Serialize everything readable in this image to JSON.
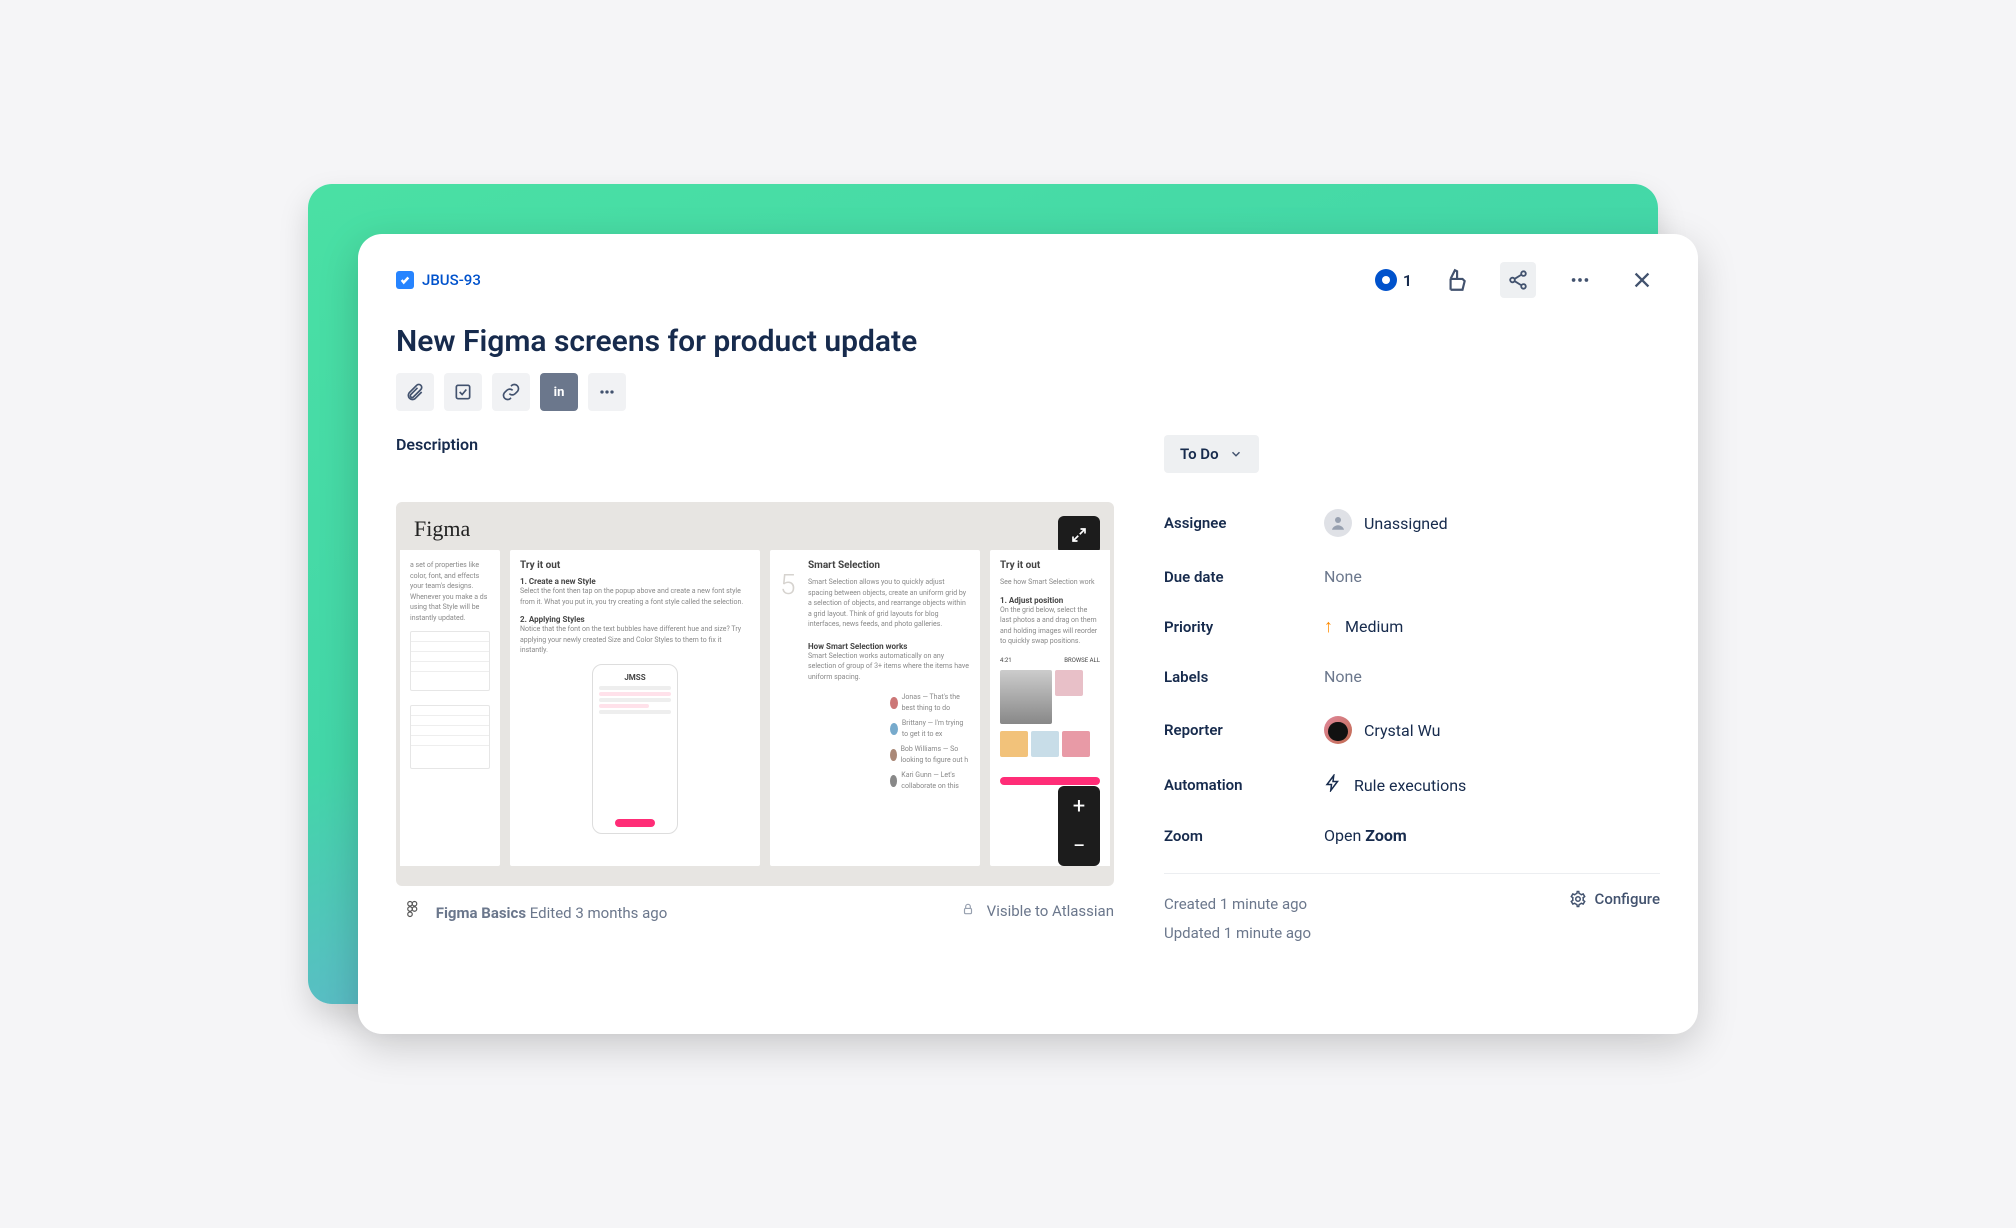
{
  "issue": {
    "key": "JBUS-93",
    "title": "New Figma screens for product update"
  },
  "description_label": "Description",
  "watch_count": "1",
  "status": {
    "label": "To Do"
  },
  "fields": {
    "assignee": {
      "label": "Assignee",
      "value": "Unassigned"
    },
    "due_date": {
      "label": "Due date",
      "value": "None"
    },
    "priority": {
      "label": "Priority",
      "value": "Medium"
    },
    "labels": {
      "label": "Labels",
      "value": "None"
    },
    "reporter": {
      "label": "Reporter",
      "value": "Crystal Wu"
    },
    "automation": {
      "label": "Automation",
      "value": "Rule executions"
    },
    "zoom": {
      "label": "Zoom",
      "value_prefix": "Open ",
      "value_bold": "Zoom"
    }
  },
  "meta": {
    "created": "Created 1 minute ago",
    "updated": "Updated 1 minute ago",
    "configure": "Configure"
  },
  "embed": {
    "header": "Figma",
    "file_name": "Figma Basics",
    "edited": "Edited 3 months ago",
    "visibility": "Visible to Atlassian",
    "board2": {
      "title": "Try it out",
      "h1": "1. Create a new Style",
      "h2": "2. Applying Styles"
    },
    "board3": {
      "num": "5",
      "title": "Smart Selection",
      "sub": "How Smart Selection works"
    },
    "board4": {
      "title": "Try it out",
      "h1": "1. Adjust position"
    }
  }
}
